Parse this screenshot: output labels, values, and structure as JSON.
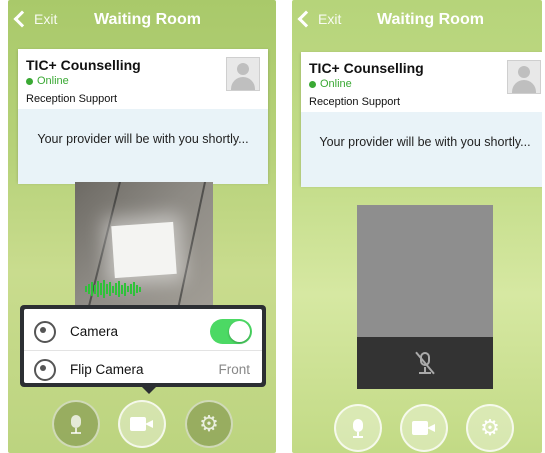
{
  "left_screen": {
    "topbar": {
      "exit_label": "Exit",
      "title": "Waiting Room"
    },
    "provider": {
      "name": "TIC+ Counselling",
      "status": "Online",
      "role": "Reception Support"
    },
    "message": "Your provider will be with you shortly...",
    "camera_menu": {
      "items": [
        {
          "label": "Camera",
          "icon": "camera-switch-icon",
          "control": "toggle",
          "toggle_on": true
        },
        {
          "label": "Flip Camera",
          "icon": "flip-camera-icon",
          "value": "Front"
        }
      ]
    },
    "controls": [
      "mic-icon",
      "video-camera-icon",
      "gear-icon"
    ]
  },
  "right_screen": {
    "topbar": {
      "exit_label": "Exit",
      "title": "Waiting Room"
    },
    "provider": {
      "name": "TIC+ Counselling",
      "status": "Online",
      "role": "Reception Support"
    },
    "message": "Your provider will be with you shortly...",
    "controls": [
      "mic-icon",
      "video-camera-icon",
      "gear-icon"
    ],
    "video_overlay_icon": "mic-muted-icon"
  },
  "colors": {
    "online_green": "#3aa934",
    "toggle_green": "#4cd964",
    "message_bg": "#e9f3f8"
  }
}
